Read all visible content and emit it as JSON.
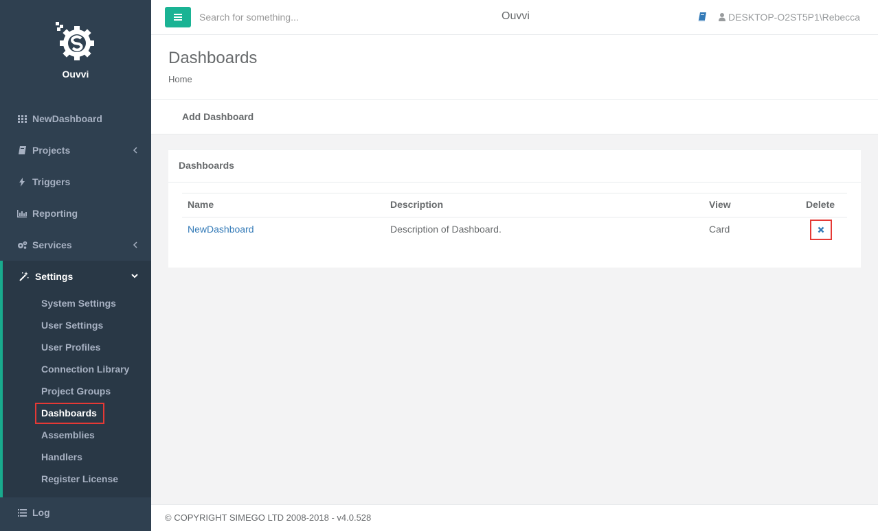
{
  "app": {
    "name": "Ouvvi"
  },
  "topbar": {
    "search_placeholder": "Search for something...",
    "title": "Ouvvi",
    "user": "DESKTOP-O2ST5P1\\Rebecca"
  },
  "sidebar": {
    "brand": "Ouvvi",
    "items": [
      {
        "label": "NewDashboard",
        "icon": "grid-icon"
      },
      {
        "label": "Projects",
        "icon": "book-icon"
      },
      {
        "label": "Triggers",
        "icon": "bolt-icon"
      },
      {
        "label": "Reporting",
        "icon": "bar-chart-icon"
      },
      {
        "label": "Services",
        "icon": "cogs-icon"
      }
    ],
    "settings": {
      "label": "Settings",
      "icon": "magic-wand-icon",
      "subitems": [
        "System Settings",
        "User Settings",
        "User Profiles",
        "Connection Library",
        "Project Groups",
        "Dashboards",
        "Assemblies",
        "Handlers",
        "Register License"
      ]
    },
    "log": {
      "label": "Log",
      "icon": "list-icon"
    }
  },
  "page": {
    "title": "Dashboards",
    "breadcrumb": "Home",
    "action": "Add Dashboard"
  },
  "panel": {
    "title": "Dashboards",
    "columns": [
      "Name",
      "Description",
      "View",
      "Delete"
    ],
    "rows": [
      {
        "name": "NewDashboard",
        "description": "Description of Dashboard.",
        "view": "Card"
      }
    ]
  },
  "footer": {
    "text": "© COPYRIGHT SIMEGO LTD 2008-2018 - v4.0.528"
  },
  "colors": {
    "sidebar": "#2f4050",
    "accent": "#1ab394",
    "highlight": "#e53935"
  }
}
